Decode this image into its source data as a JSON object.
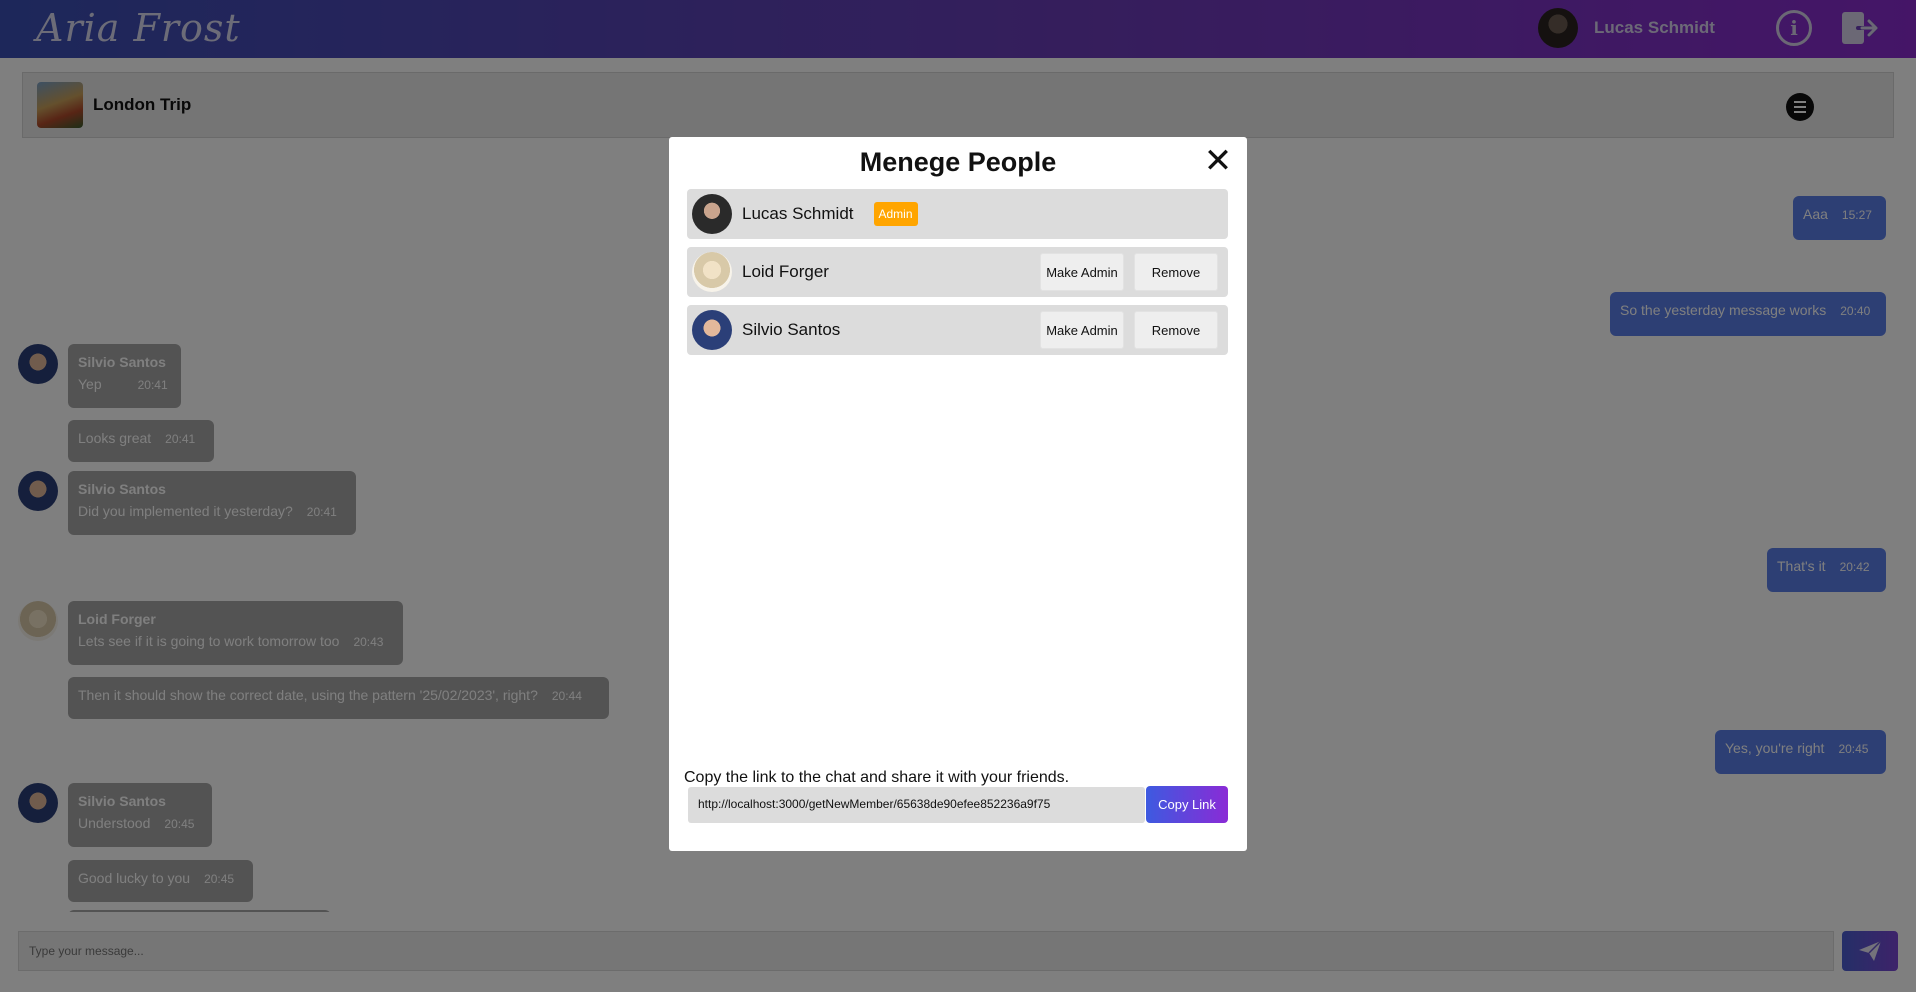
{
  "header": {
    "brand": "Aria Frost",
    "username": "Lucas Schmidt",
    "info_icon": "info-icon",
    "logout_icon": "logout-icon"
  },
  "chat": {
    "title": "London Trip",
    "menu_icon": "menu-icon",
    "messages": [
      {
        "sender": "",
        "text": "Aaa",
        "time": "15:27",
        "direction": "out"
      },
      {
        "sender": "",
        "text": "So the yesterday message works",
        "time": "20:40",
        "direction": "out"
      },
      {
        "sender": "Silvio Santos",
        "text": "Yep",
        "time": "20:41",
        "direction": "in"
      },
      {
        "sender": "",
        "text": "Looks great",
        "time": "20:41",
        "direction": "in"
      },
      {
        "sender": "Silvio Santos",
        "text": "Did you implemented it yesterday?",
        "time": "20:41",
        "direction": "in"
      },
      {
        "sender": "",
        "text": "That's it",
        "time": "20:42",
        "direction": "out"
      },
      {
        "sender": "Loid Forger",
        "text": "Lets see if it is going to work tomorrow too",
        "time": "20:43",
        "direction": "in"
      },
      {
        "sender": "",
        "text": "Then it should show the correct date, using the pattern '25/02/2023', right?",
        "time": "20:44",
        "direction": "in"
      },
      {
        "sender": "",
        "text": "Yes, you're right",
        "time": "20:45",
        "direction": "out"
      },
      {
        "sender": "Silvio Santos",
        "text": "Understood",
        "time": "20:45",
        "direction": "in"
      },
      {
        "sender": "",
        "text": "Good lucky to you",
        "time": "20:45",
        "direction": "in"
      }
    ],
    "input_placeholder": "Type your message...",
    "send_icon": "send-icon"
  },
  "modal": {
    "title": "Menege People",
    "close_icon": "close-icon",
    "members": [
      {
        "name": "Lucas Schmidt",
        "badge": "Admin"
      },
      {
        "name": "Loid Forger",
        "make_admin": "Make Admin",
        "remove": "Remove"
      },
      {
        "name": "Silvio Santos",
        "make_admin": "Make Admin",
        "remove": "Remove"
      }
    ],
    "share_text": "Copy the link to the chat and share it with your friends.",
    "link": "http://localhost:3000/getNewMember/65638de90efee852236a9f75",
    "copy_label": "Copy Link"
  }
}
